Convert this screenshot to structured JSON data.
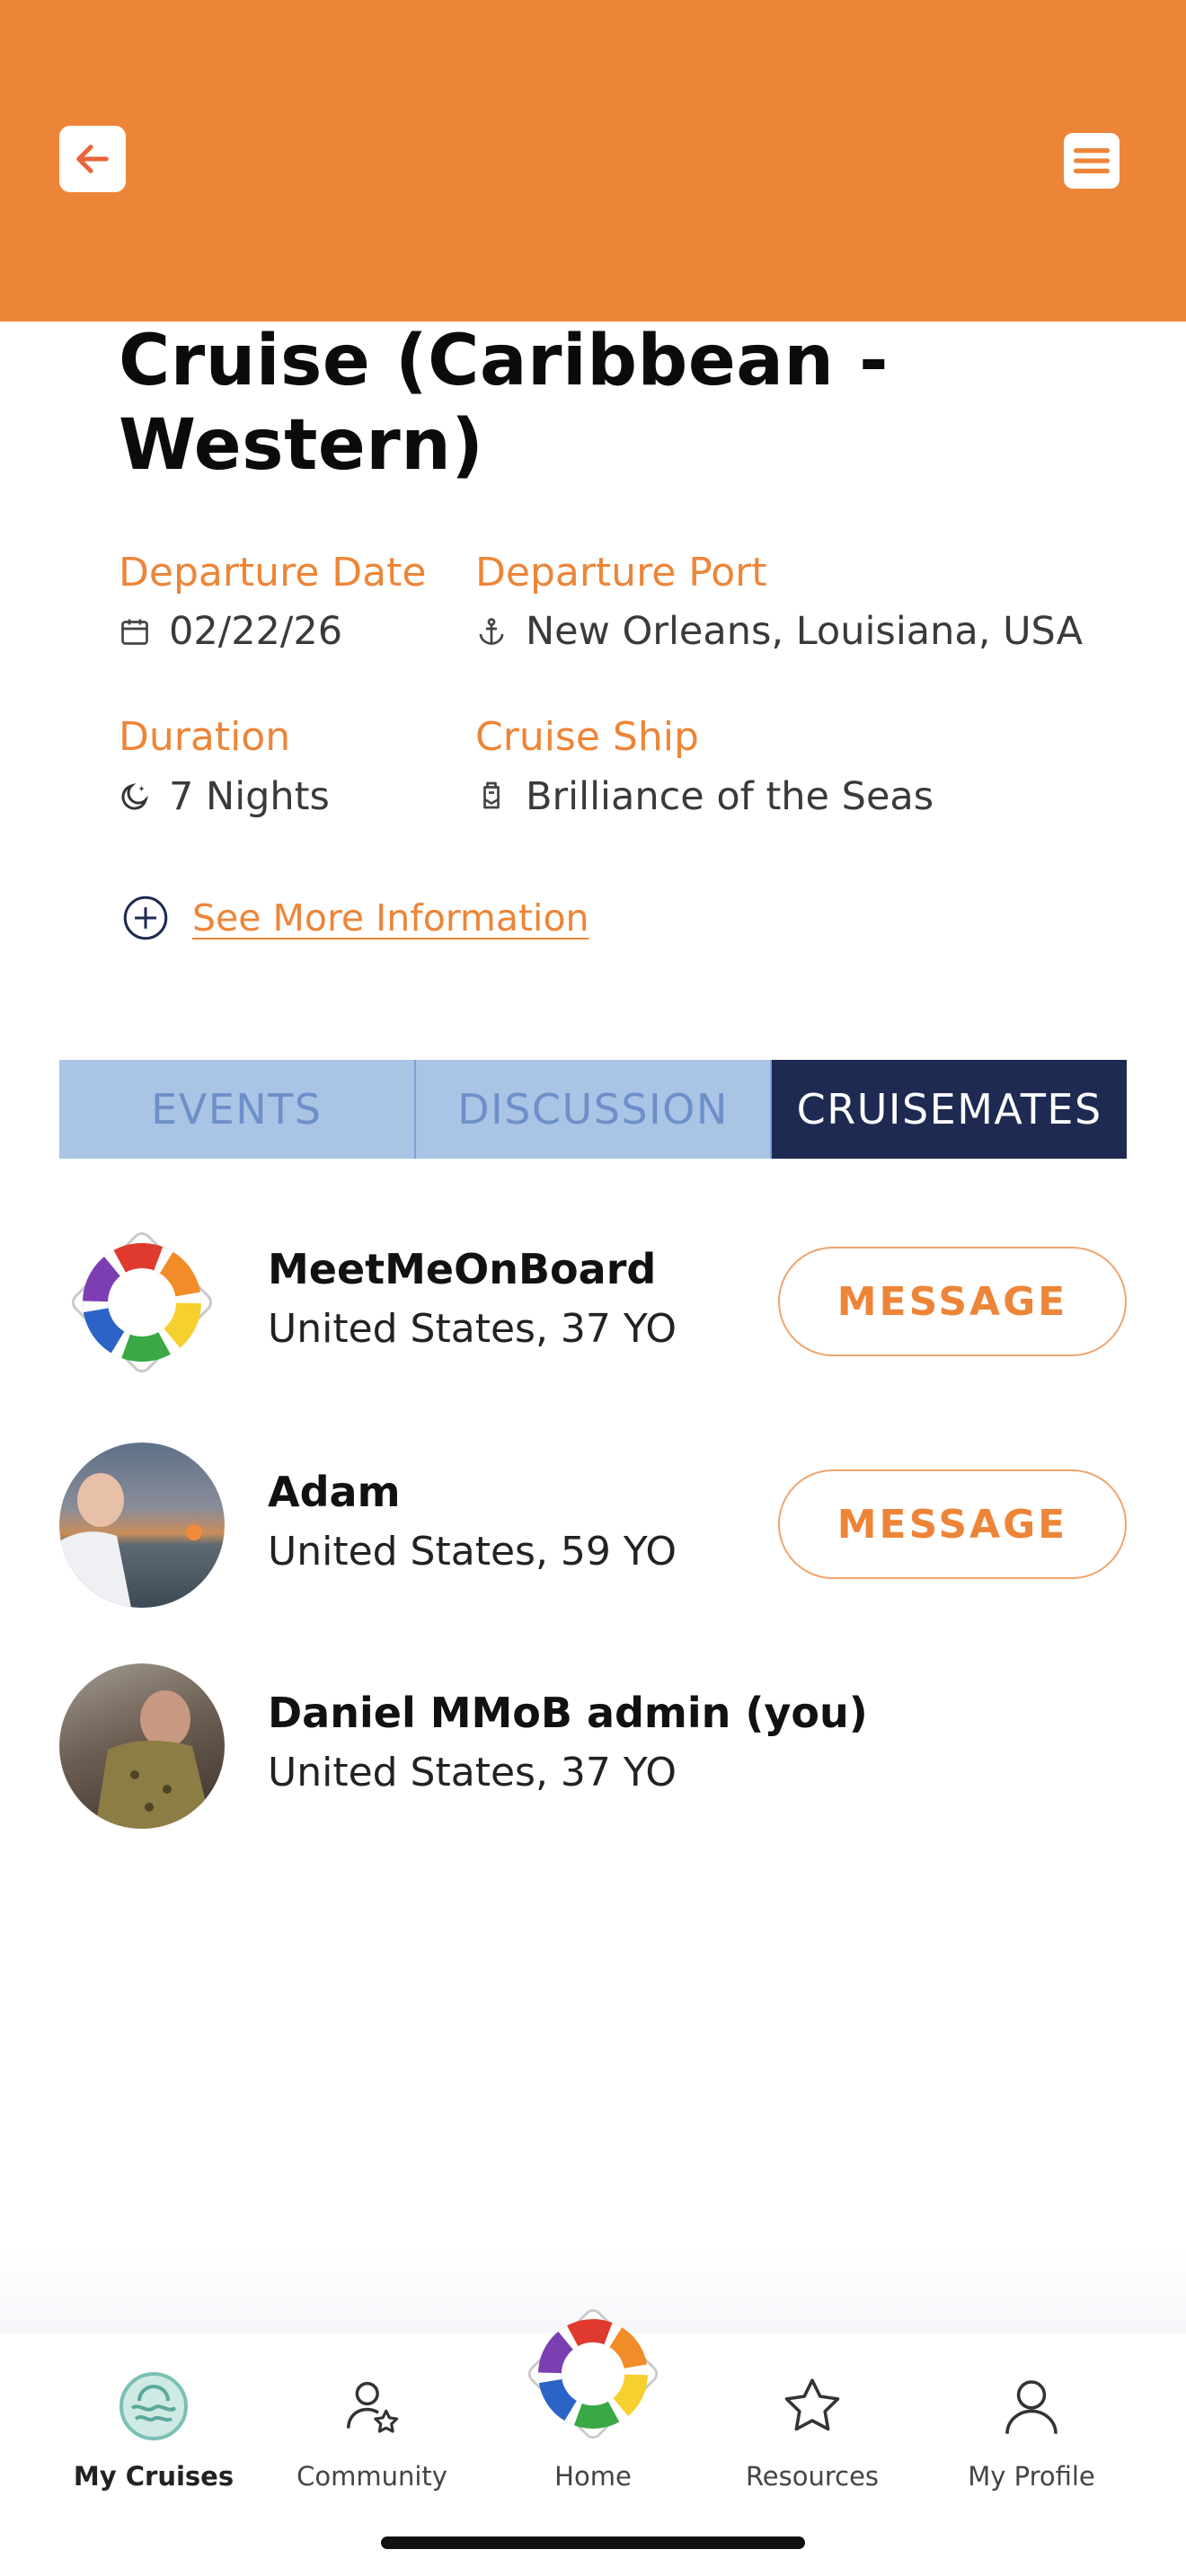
{
  "header": {
    "back_icon": "arrow-left-icon",
    "menu_icon": "menu-icon",
    "color": "#ed8538"
  },
  "cruise": {
    "title": "Cruise (Caribbean - Western)",
    "departure_date_label": "Departure Date",
    "departure_date": "02/22/26",
    "departure_port_label": "Departure Port",
    "departure_port": "New Orleans, Louisiana, USA",
    "duration_label": "Duration",
    "duration": "7 Nights",
    "ship_label": "Cruise Ship",
    "ship": "Brilliance of the Seas",
    "more_info": "See More Information"
  },
  "tabs": [
    {
      "label": "EVENTS",
      "active": false
    },
    {
      "label": "DISCUSSION",
      "active": false
    },
    {
      "label": "CRUISEMATES",
      "active": true
    }
  ],
  "cruisemates": [
    {
      "name": "MeetMeOnBoard",
      "details": "United States, 37 YO",
      "button": "MESSAGE"
    },
    {
      "name": "Adam",
      "details": "United States, 59 YO",
      "button": "MESSAGE"
    },
    {
      "name": "Daniel MMoB admin (you)",
      "details": "United States, 37 YO"
    }
  ],
  "nav": [
    {
      "label": "My Cruises",
      "icon": "cruise-icon",
      "active": true
    },
    {
      "label": "Community",
      "icon": "community-icon"
    },
    {
      "label": "Home",
      "icon": "lifebuoy-icon"
    },
    {
      "label": "Resources",
      "icon": "star-icon"
    },
    {
      "label": "My Profile",
      "icon": "profile-icon"
    }
  ],
  "colors": {
    "accent": "#ed8538",
    "tab_active": "#1f2a52",
    "tab_inactive": "#aac4e6"
  }
}
